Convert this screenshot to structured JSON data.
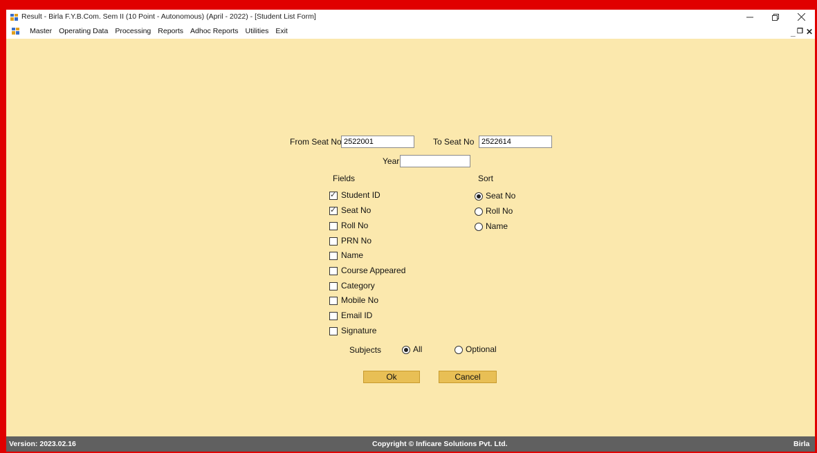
{
  "window": {
    "title": "Result - Birla  F.Y.B.Com. Sem II (10 Point - Autonomous) (April - 2022) - [Student List Form]"
  },
  "menu": {
    "items": [
      "Master",
      "Operating Data",
      "Processing",
      "Reports",
      "Adhoc Reports",
      "Utilities",
      "Exit"
    ]
  },
  "form": {
    "from_seat_label": "From Seat No",
    "from_seat_value": "2522001",
    "to_seat_label": "To Seat No",
    "to_seat_value": "2522614",
    "year_label": "Year",
    "year_value": "",
    "fields_label": "Fields",
    "sort_label": "Sort",
    "fields": [
      {
        "label": "Student ID",
        "checked": true
      },
      {
        "label": "Seat No",
        "checked": true
      },
      {
        "label": "Roll No",
        "checked": false
      },
      {
        "label": "PRN No",
        "checked": false
      },
      {
        "label": "Name",
        "checked": false
      },
      {
        "label": "Course Appeared",
        "checked": false
      },
      {
        "label": "Category",
        "checked": false
      },
      {
        "label": "Mobile No",
        "checked": false
      },
      {
        "label": "Email ID",
        "checked": false
      },
      {
        "label": "Signature",
        "checked": false
      }
    ],
    "sort_options": [
      {
        "label": "Seat No",
        "selected": true
      },
      {
        "label": "Roll No",
        "selected": false
      },
      {
        "label": "Name",
        "selected": false
      }
    ],
    "subjects_label": "Subjects",
    "subjects_options": [
      {
        "label": "All",
        "selected": true
      },
      {
        "label": "Optional",
        "selected": false
      }
    ],
    "ok_label": "Ok",
    "cancel_label": "Cancel"
  },
  "status": {
    "version": "Version: 2023.02.16",
    "copyright": "Copyright © Inficare Solutions Pvt. Ltd.",
    "client": "Birla"
  },
  "colors": {
    "client_bg": "#fbe8ad",
    "button_bg": "#e8bf55",
    "status_bg": "#606060",
    "frame_border": "#e00000"
  }
}
